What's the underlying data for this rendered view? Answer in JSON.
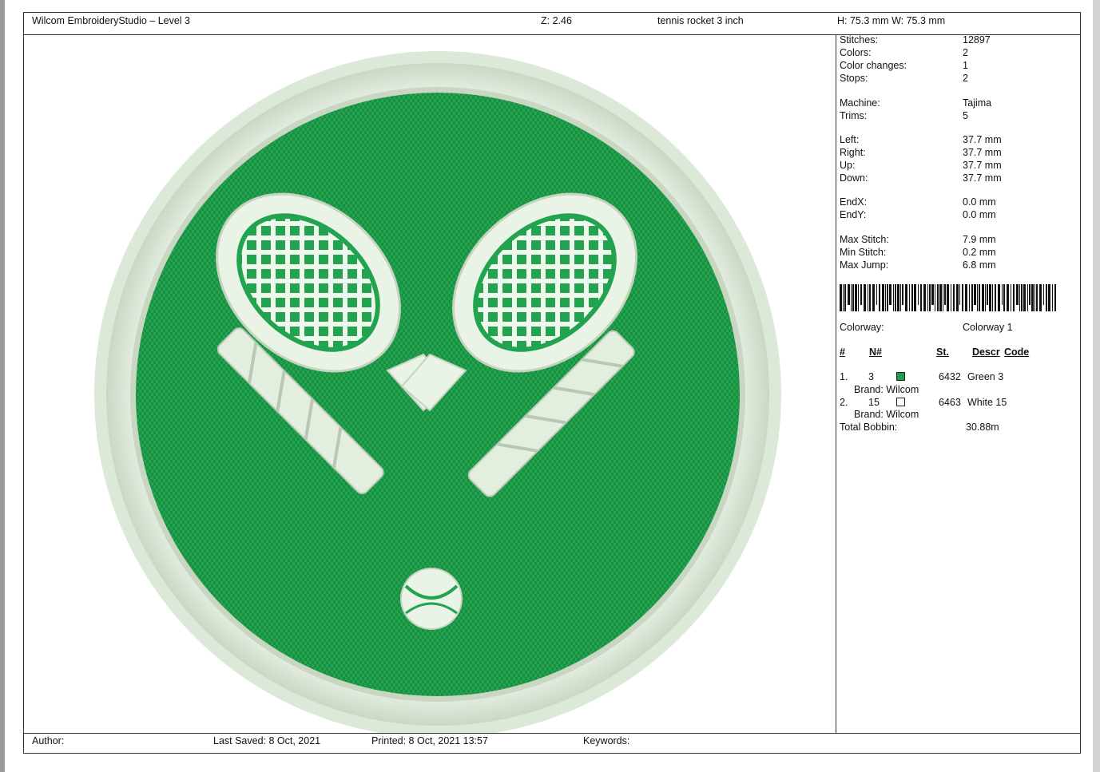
{
  "header": {
    "app_title": "Wilcom EmbroideryStudio – Level 3",
    "zoom": "Z: 2.46",
    "design_name": "tennis rocket 3 inch",
    "size": "H: 75.3 mm   W: 75.3 mm"
  },
  "stats": [
    {
      "label": "Stitches:",
      "value": "12897"
    },
    {
      "label": "Colors:",
      "value": "2"
    },
    {
      "label": "Color changes:",
      "value": "1"
    },
    {
      "label": "Stops:",
      "value": "2"
    },
    {
      "label": "Machine:",
      "value": "Tajima"
    },
    {
      "label": "Trims:",
      "value": "5"
    },
    {
      "label": "Left:",
      "value": "37.7 mm"
    },
    {
      "label": "Right:",
      "value": "37.7 mm"
    },
    {
      "label": "Up:",
      "value": "37.7 mm"
    },
    {
      "label": "Down:",
      "value": "37.7 mm"
    },
    {
      "label": "EndX:",
      "value": "0.0 mm"
    },
    {
      "label": "EndY:",
      "value": "0.0 mm"
    },
    {
      "label": "Max Stitch:",
      "value": "7.9 mm"
    },
    {
      "label": "Min Stitch:",
      "value": "0.2 mm"
    },
    {
      "label": "Max Jump:",
      "value": "6.8 mm"
    }
  ],
  "colorway": {
    "label": "Colorway:",
    "value": "Colorway 1"
  },
  "color_table": {
    "headers": [
      "#",
      "N#",
      "St.",
      "Descr",
      "Code"
    ],
    "rows": [
      {
        "index": "1.",
        "n": "3",
        "swatch": "#1e9e4a",
        "stitches": "6432",
        "descr": "Green 3",
        "brand": "Brand: Wilcom"
      },
      {
        "index": "2.",
        "n": "15",
        "swatch": "#ffffff",
        "stitches": "6463",
        "descr": "White 15",
        "brand": "Brand: Wilcom"
      }
    ],
    "total_label": "Total Bobbin:",
    "total_value": "30.88m"
  },
  "footer": {
    "author": "Author:",
    "last_saved": "Last Saved:  8 Oct, 2021",
    "printed": "Printed:  8 Oct, 2021 13:57",
    "keywords": "Keywords:"
  },
  "design_colors": {
    "green": "#1f9f4c",
    "thread_white": "#e9f3e6"
  }
}
